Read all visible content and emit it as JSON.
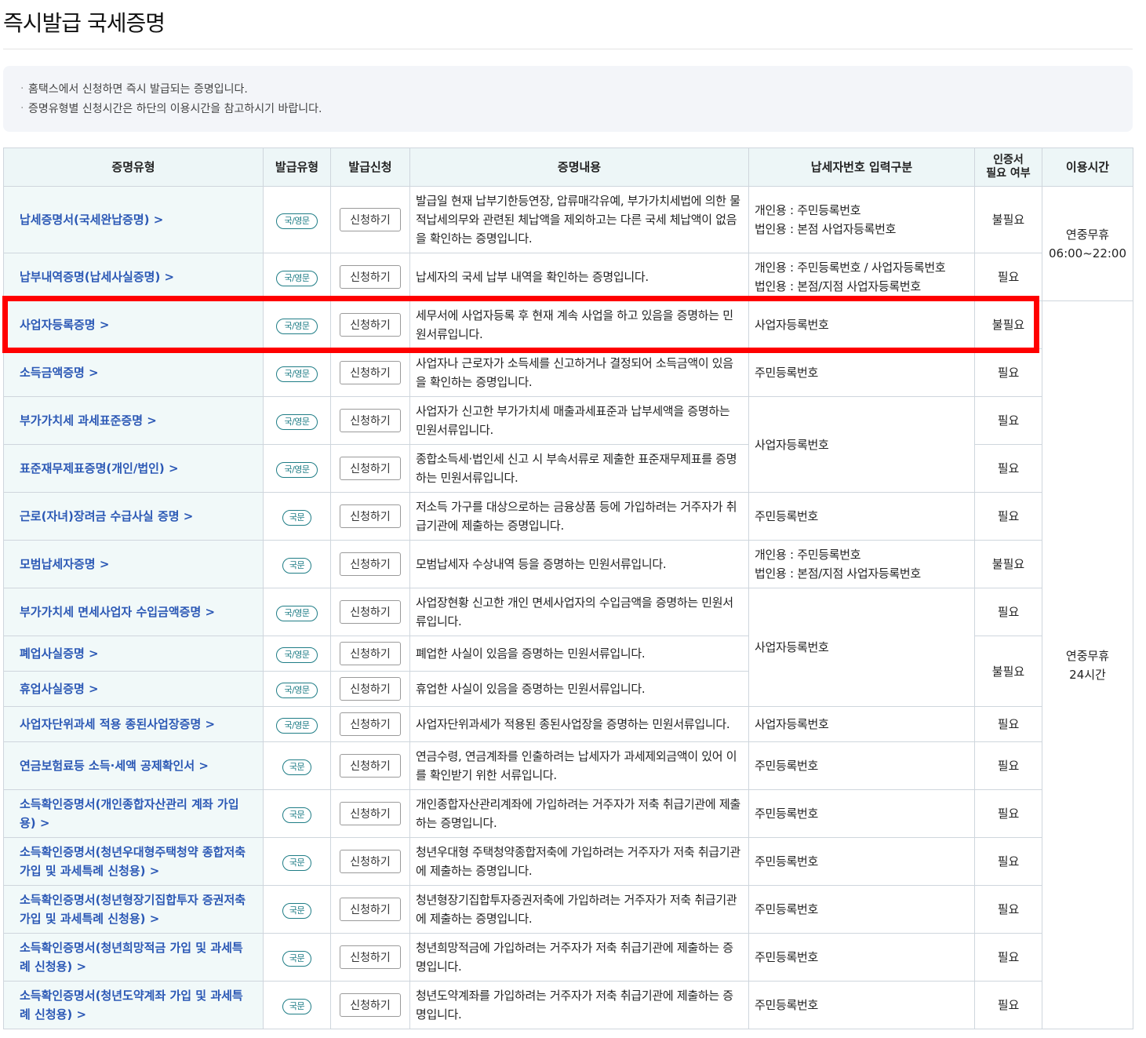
{
  "page": {
    "title": "즉시발급 국세증명",
    "notices": [
      "홈택스에서 신청하면 즉시 발급되는 증명입니다.",
      "증명유형별 신청시간은 하단의 이용시간을 참고하시기 바랍니다."
    ]
  },
  "table": {
    "headers": {
      "type": "증명유형",
      "issue_type": "발급유형",
      "apply": "발급신청",
      "content": "증명내용",
      "input_type": "납세자번호 입력구분",
      "cert_line1": "인증서",
      "cert_line2": "필요 여부",
      "time": "이용시간"
    },
    "apply_label": "신청하기",
    "times": {
      "group1_line1": "연중무휴",
      "group1_line2": "06:00~22:00",
      "group2_line1": "연중무휴",
      "group2_line2": "24시간"
    },
    "shared": {
      "business_no_group1": "사업자등록번호",
      "business_no_group2": "사업자등록번호",
      "not_required_group": "불필요"
    },
    "rows": [
      {
        "name": "납세증명서(국세완납증명) >",
        "badge": "국/영문",
        "content": "발급일 현재 납부기한등연장, 압류매각유예, 부가가치세법에 의한 물적납세의무와 관련된 체납액을 제외하고는 다른 국세 체납액이 없음을 확인하는 증명입니다.",
        "input_line1": "개인용 : 주민등록번호",
        "input_line2": "법인용 : 본점 사업자등록번호",
        "need": "불필요"
      },
      {
        "name": "납부내역증명(납세사실증명) >",
        "badge": "국/영문",
        "content": "납세자의 국세 납부 내역을 확인하는 증명입니다.",
        "input_line1": "개인용 : 주민등록번호 / 사업자등록번호",
        "input_line2": "법인용 : 본점/지점 사업자등록번호",
        "need": "필요"
      },
      {
        "name": "사업자등록증명 >",
        "badge": "국/영문",
        "content": "세무서에 사업자등록 후 현재 계속 사업을 하고 있음을 증명하는 민원서류입니다.",
        "input": "사업자등록번호",
        "need": "불필요"
      },
      {
        "name": "소득금액증명 >",
        "badge": "국/영문",
        "content": "사업자나 근로자가 소득세를 신고하거나 결정되어 소득금액이 있음을 확인하는 증명입니다.",
        "input": "주민등록번호",
        "need": "필요"
      },
      {
        "name": "부가가치세 과세표준증명 >",
        "badge": "국/영문",
        "content": "사업자가 신고한 부가가치세 매출과세표준과 납부세액을 증명하는 민원서류입니다.",
        "need": "필요"
      },
      {
        "name": "표준재무제표증명(개인/법인) >",
        "badge": "국/영문",
        "content": "종합소득세·법인세 신고 시 부속서류로 제출한 표준재무제표를 증명하는 민원서류입니다.",
        "need": "필요"
      },
      {
        "name": "근로(자녀)장려금 수급사실 증명 >",
        "badge": "국문",
        "content": "저소득 가구를 대상으로하는 금융상품 등에 가입하려는 거주자가 취급기관에 제출하는 증명입니다.",
        "input": "주민등록번호",
        "need": "필요"
      },
      {
        "name": "모범납세자증명 >",
        "badge": "국문",
        "content": "모범납세자 수상내역 등을 증명하는 민원서류입니다.",
        "input_line1": "개인용 : 주민등록번호",
        "input_line2": "법인용 : 본점/지점 사업자등록번호",
        "need": "불필요"
      },
      {
        "name": "부가가치세 면세사업자 수입금액증명 >",
        "badge": "국/영문",
        "content": "사업장현황 신고한 개인 면세사업자의 수입금액을 증명하는 민원서류입니다.",
        "need": "필요"
      },
      {
        "name": "폐업사실증명 >",
        "badge": "국/영문",
        "content": "폐업한 사실이 있음을 증명하는 민원서류입니다."
      },
      {
        "name": "휴업사실증명 >",
        "badge": "국/영문",
        "content": "휴업한 사실이 있음을 증명하는 민원서류입니다."
      },
      {
        "name": "사업자단위과세 적용 종된사업장증명 >",
        "badge": "국/영문",
        "content": "사업자단위과세가 적용된 종된사업장을 증명하는 민원서류입니다.",
        "input": "사업자등록번호",
        "need": "필요"
      },
      {
        "name": "연금보험료등 소득·세액 공제확인서 >",
        "badge": "국문",
        "content": "연금수령, 연금계좌를 인출하려는 납세자가 과세제외금액이 있어 이를 확인받기 위한 서류입니다.",
        "input": "주민등록번호",
        "need": "필요"
      },
      {
        "name": "소득확인증명서(개인종합자산관리 계좌 가입용) >",
        "badge": "국문",
        "content": "개인종합자산관리계좌에 가입하려는 거주자가 저축 취급기관에 제출하는 증명입니다.",
        "input": "주민등록번호",
        "need": "필요"
      },
      {
        "name": "소득확인증명서(청년우대형주택청약 종합저축 가입 및 과세특례 신청용) >",
        "badge": "국문",
        "content": "청년우대형 주택청약종합저축에 가입하려는 거주자가 저축 취급기관에 제출하는 증명입니다.",
        "input": "주민등록번호",
        "need": "필요"
      },
      {
        "name": "소득확인증명서(청년형장기집합투자 증권저축 가입 및 과세특례 신청용) >",
        "badge": "국문",
        "content": "청년형장기집합투자증권저축에 가입하려는 거주자가 저축 취급기관에 제출하는 증명입니다.",
        "input": "주민등록번호",
        "need": "필요"
      },
      {
        "name": "소득확인증명서(청년희망적금 가입 및 과세특례 신청용) >",
        "badge": "국문",
        "content": "청년희망적금에 가입하려는 거주자가 저축 취급기관에 제출하는 증명입니다.",
        "input": "주민등록번호",
        "need": "필요"
      },
      {
        "name": "소득확인증명서(청년도약계좌 가입 및 과세특례 신청용) >",
        "badge": "국문",
        "content": "청년도약계좌를 가입하려는 거주자가 저축 취급기관에 제출하는 증명입니다.",
        "input": "주민등록번호",
        "need": "필요"
      }
    ]
  },
  "highlight": {
    "target": "사업자등록증명 row",
    "color": "#ff0000"
  }
}
